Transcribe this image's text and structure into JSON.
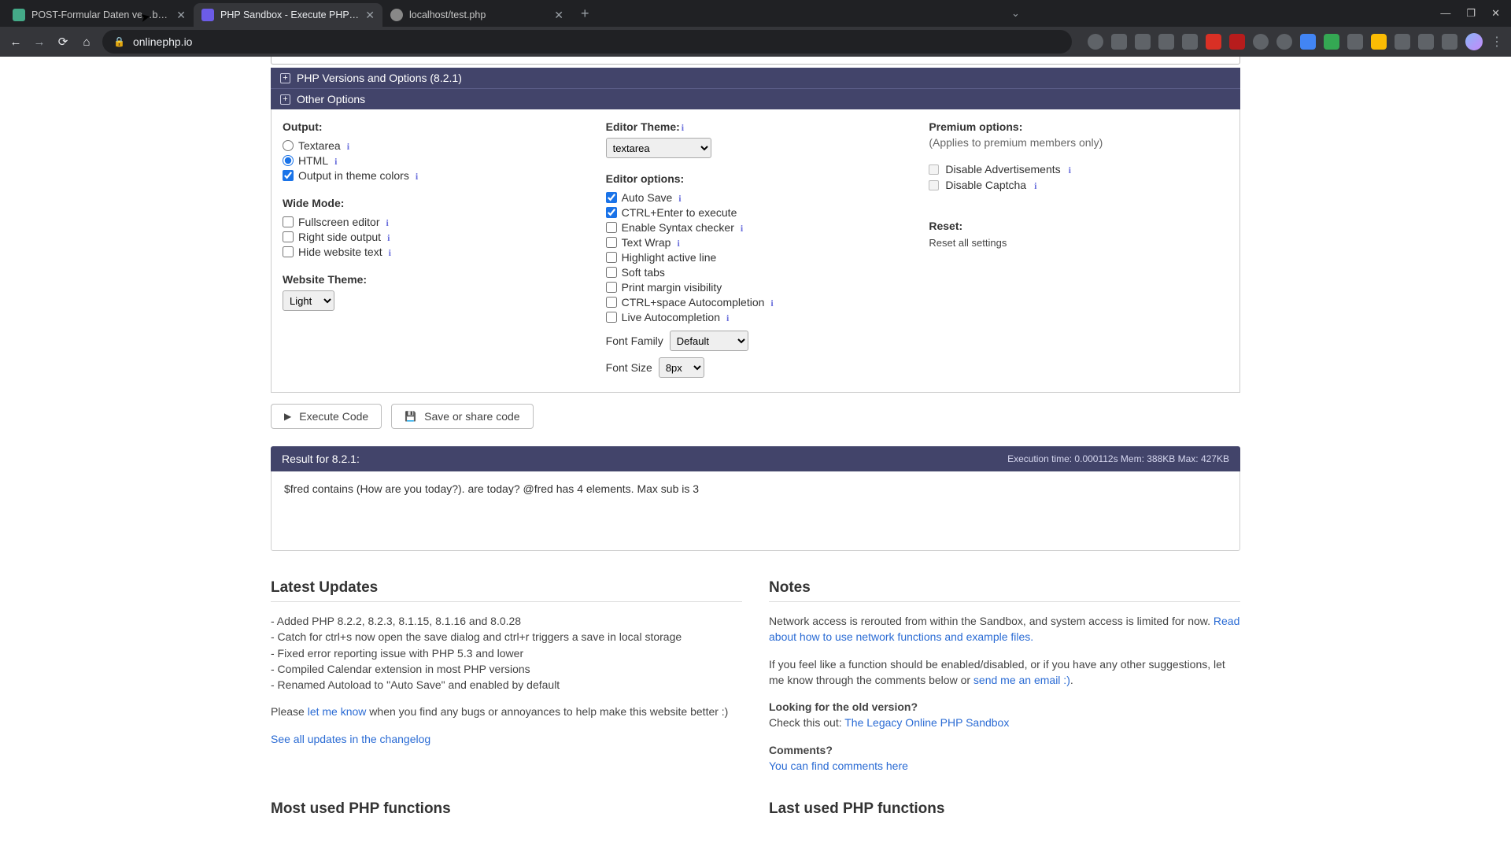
{
  "browser": {
    "tabs": [
      {
        "title": "POST-Formular Daten ve…beite"
      },
      {
        "title": "PHP Sandbox - Execute PHP cod"
      },
      {
        "title": "localhost/test.php"
      }
    ],
    "new_tab": "+",
    "chevron": "⌄",
    "win": {
      "min": "—",
      "max": "❐",
      "close": "✕"
    },
    "nav": {
      "back": "←",
      "forward": "→",
      "reload": "⟳",
      "home": "⌂"
    },
    "lock": "🔒",
    "url": "onlinephp.io",
    "kebab": "⋮"
  },
  "accordion": {
    "versions": "PHP Versions and Options (8.2.1)",
    "other": "Other Options"
  },
  "col1": {
    "output_h": "Output:",
    "textarea": "Textarea",
    "html": "HTML",
    "theme_colors": "Output in theme colors",
    "wide_h": "Wide Mode:",
    "fullscreen": "Fullscreen editor",
    "rightside": "Right side output",
    "hidetext": "Hide website text",
    "theme_h": "Website Theme:",
    "theme_sel": "Light"
  },
  "col2": {
    "editor_theme_h": "Editor Theme:",
    "editor_theme_sel": "textarea",
    "editor_options_h": "Editor options:",
    "autosave": "Auto Save",
    "ctrlenter": "CTRL+Enter to execute",
    "syntax": "Enable Syntax checker",
    "textwrap": "Text Wrap",
    "highlight": "Highlight active line",
    "softtabs": "Soft tabs",
    "printmargin": "Print margin visibility",
    "ctrlspace": "CTRL+space Autocompletion",
    "liveauto": "Live Autocompletion",
    "fontfam_l": "Font Family",
    "fontfam_sel": "Default",
    "fontsize_l": "Font Size",
    "fontsize_sel": "8px"
  },
  "col3": {
    "premium_h": "Premium options:",
    "premium_note": "(Applies to premium members only)",
    "disable_ads": "Disable Advertisements",
    "disable_captcha": "Disable Captcha",
    "reset_h": "Reset:",
    "reset_link": "Reset all settings"
  },
  "buttons": {
    "execute": "Execute Code",
    "save": "Save or share code"
  },
  "result": {
    "title": "Result for 8.2.1:",
    "meta": "Execution time: 0.000112s Mem: 388KB Max: 427KB",
    "body": "$fred contains (How are you today?). are today? @fred has 4 elements. Max sub is 3"
  },
  "updates": {
    "title": "Latest Updates",
    "l1": "- Added PHP 8.2.2, 8.2.3, 8.1.15, 8.1.16 and 8.0.28",
    "l2": "- Catch for ctrl+s now open the save dialog and ctrl+r triggers a save in local storage",
    "l3": "- Fixed error reporting issue with PHP 5.3 and lower",
    "l4": "- Compiled Calendar extension in most PHP versions",
    "l5": "- Renamed Autoload to \"Auto Save\" and enabled by default",
    "bugs_a": "Please ",
    "bugs_link": "let me know",
    "bugs_b": " when you find any bugs or annoyances to help make this website better :)",
    "changelog": "See all updates in the changelog"
  },
  "notes": {
    "title": "Notes",
    "net_a": "Network access is rerouted from within the Sandbox, and system access is limited for now. ",
    "net_link": "Read about how to use network functions and example files.",
    "feel_a": "If you feel like a function should be enabled/disabled, or if you have any other suggestions, let me know through the comments below or ",
    "feel_link": "send me an email :)",
    "feel_b": ".",
    "old_h": "Looking for the old version?",
    "old_a": "Check this out: ",
    "old_link": "The Legacy Online PHP Sandbox",
    "comments_h": "Comments?",
    "comments_link": "You can find comments here"
  },
  "overflow": {
    "most": "Most used PHP functions",
    "last": "Last used PHP functions"
  }
}
